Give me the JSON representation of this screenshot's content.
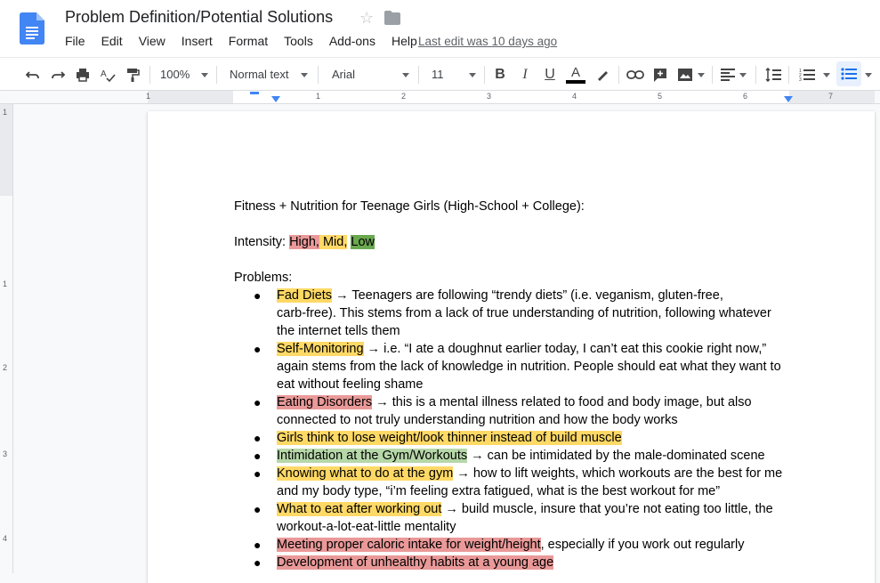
{
  "doc": {
    "title": "Problem Definition/Potential Solutions",
    "last_edit": "Last edit was 10 days ago"
  },
  "menu": [
    "File",
    "Edit",
    "View",
    "Insert",
    "Format",
    "Tools",
    "Add-ons",
    "Help"
  ],
  "toolbar": {
    "zoom": "100%",
    "style": "Normal text",
    "font": "Arial",
    "size": "11",
    "icons": [
      "undo-icon",
      "redo-icon",
      "print-icon",
      "spellcheck-icon",
      "paint-format-icon",
      "bold-icon",
      "italic-icon",
      "underline-icon",
      "text-color-icon",
      "highlight-icon",
      "link-icon",
      "comment-icon",
      "image-icon",
      "align-icon",
      "line-spacing-icon",
      "numbered-list-icon",
      "bulleted-list-icon"
    ]
  },
  "ruler": [
    "1",
    "1",
    "2",
    "3",
    "4",
    "5",
    "6",
    "7"
  ],
  "vruler": [
    "1",
    "1",
    "2",
    "3",
    "4"
  ],
  "body": {
    "heading": "Fitness + Nutrition for Teenage Girls (High-School + College):",
    "intensity_label": "Intensity: ",
    "intensity_high": "High,",
    "intensity_mid": " Mid,",
    "intensity_low": "Low",
    "problems_label": "Problems:",
    "items": [
      {
        "hl": "Fad Diets",
        "rest1": " → Teenagers are following “trendy diets” (i.e. veganism, gluten-free,",
        "rest2": "carb-free). This stems from a lack of true understanding of nutrition, following whatever",
        "rest3": "the internet tells them"
      },
      {
        "hl": "Self-Monitoring",
        "rest1": " → i.e. “I ate a doughnut earlier today, I can’t eat this cookie right now,”",
        "rest2": "again stems from the lack of knowledge in nutrition. People should eat what they want to",
        "rest3": "eat without feeling shame"
      },
      {
        "hl": "Eating Disorders",
        "rest1": " → this is a mental illness related to food and body image, but also",
        "rest2": "connected to not truly understanding nutrition and how the body works"
      },
      {
        "hl": "Girls think to lose weight/look thinner instead of build muscle"
      },
      {
        "hl": "Intimidation at the Gym/Workouts",
        "rest1": " → can be intimidated by the male-dominated scene"
      },
      {
        "hl": "Knowing what to do at the gym",
        "rest1": " → how to lift weights, which workouts are the best for me",
        "rest2": "and my body type, “i’m feeling extra fatigued, what is the best workout for me”"
      },
      {
        "hl": "What to eat after working out",
        "rest1": " → build muscle, insure that you’re not eating too little, the",
        "rest2": "workout-a-lot-eat-little mentality"
      },
      {
        "hl": "Meeting proper caloric intake for weight/height",
        "rest1": ", especially if you work out regularly"
      },
      {
        "hl": "Development of unhealthy habits at a young age"
      }
    ]
  },
  "colors": {
    "high": "#ea9999",
    "mid": "#ffd966",
    "low": "#6aa84f",
    "light_green": "#b6d7a8",
    "accent": "#1a73e8"
  }
}
